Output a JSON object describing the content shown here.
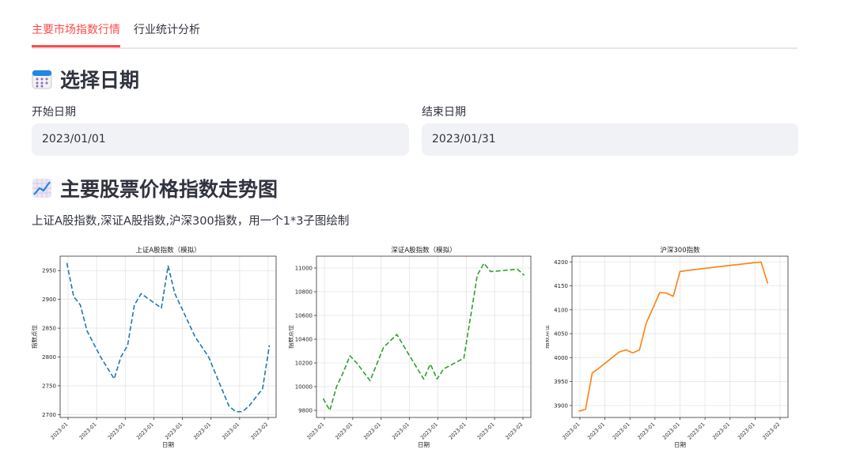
{
  "tabs": [
    {
      "label": "主要市场指数行情"
    },
    {
      "label": "行业统计分析"
    }
  ],
  "date_section": {
    "heading": "选择日期",
    "start_label": "开始日期",
    "start_value": "2023/01/01",
    "end_label": "结束日期",
    "end_value": "2023/01/31"
  },
  "chart_section": {
    "heading": "主要股票价格指数走势图",
    "caption": "上证A股指数,深证A股指数,沪深300指数，用一个1*3子图绘制"
  },
  "chart_data": [
    {
      "type": "line",
      "title": "上证A股指数（模拟）",
      "xlabel": "日期",
      "ylabel": "指数点位",
      "color": "#1f77b4",
      "dash": "dashed",
      "x": [
        1,
        2,
        3,
        4,
        6,
        8,
        9,
        10,
        11,
        12,
        15,
        16,
        17,
        18,
        19,
        20,
        22,
        25,
        26,
        27,
        28,
        29,
        30,
        31
      ],
      "values": [
        2963,
        2905,
        2890,
        2845,
        2800,
        2762,
        2800,
        2820,
        2890,
        2910,
        2885,
        2958,
        2910,
        2885,
        2860,
        2835,
        2800,
        2715,
        2705,
        2705,
        2715,
        2730,
        2745,
        2820
      ],
      "ylim": [
        2695,
        2975
      ],
      "yticks": [
        2700,
        2750,
        2800,
        2850,
        2900,
        2950
      ],
      "xticks": [
        "2023-01",
        "2023-01",
        "2023-01",
        "2023-01",
        "2023-01",
        "2023-01",
        "2023-01",
        "2023-02"
      ]
    },
    {
      "type": "line",
      "title": "深证A股指数（模拟）",
      "xlabel": "日期",
      "ylabel": "指数点位",
      "color": "#2ca02c",
      "dash": "dashed",
      "x": [
        1,
        2,
        3,
        4,
        5,
        6,
        8,
        10,
        12,
        14,
        16,
        17,
        18,
        19,
        20,
        22,
        24,
        25,
        26,
        28,
        30,
        31
      ],
      "values": [
        9900,
        9800,
        10000,
        10120,
        10260,
        10200,
        10050,
        10330,
        10440,
        10250,
        10065,
        10190,
        10065,
        10150,
        10180,
        10240,
        10940,
        11040,
        10970,
        10980,
        10990,
        10940
      ],
      "ylim": [
        9740,
        11100
      ],
      "yticks": [
        9800,
        10000,
        10200,
        10400,
        10600,
        10800,
        11000
      ],
      "xticks": [
        "2023-01",
        "2023-01",
        "2023-01",
        "2023-01",
        "2023-01",
        "2023-01",
        "2023-01",
        "2023-02"
      ]
    },
    {
      "type": "line",
      "title": "沪深300指数",
      "xlabel": "日期",
      "ylabel": "指数点位",
      "color": "#ff7f0e",
      "dash": "solid",
      "x": [
        1,
        2,
        3,
        4,
        7,
        8,
        9,
        10,
        11,
        12,
        13,
        14,
        15,
        16,
        17,
        23,
        28,
        29
      ],
      "values": [
        3888,
        3892,
        3968,
        3978,
        4012,
        4016,
        4010,
        4016,
        4072,
        4104,
        4136,
        4135,
        4128,
        4180,
        4182,
        4192,
        4200,
        4155
      ],
      "ylim": [
        3875,
        4212
      ],
      "yticks": [
        3900,
        3950,
        4000,
        4050,
        4100,
        4150,
        4200
      ],
      "xticks": [
        "2023-01",
        "2023-01",
        "2023-01",
        "2023-01",
        "2023-01",
        "2023-01",
        "2023-01",
        "2023-01",
        "2023-02"
      ]
    }
  ]
}
